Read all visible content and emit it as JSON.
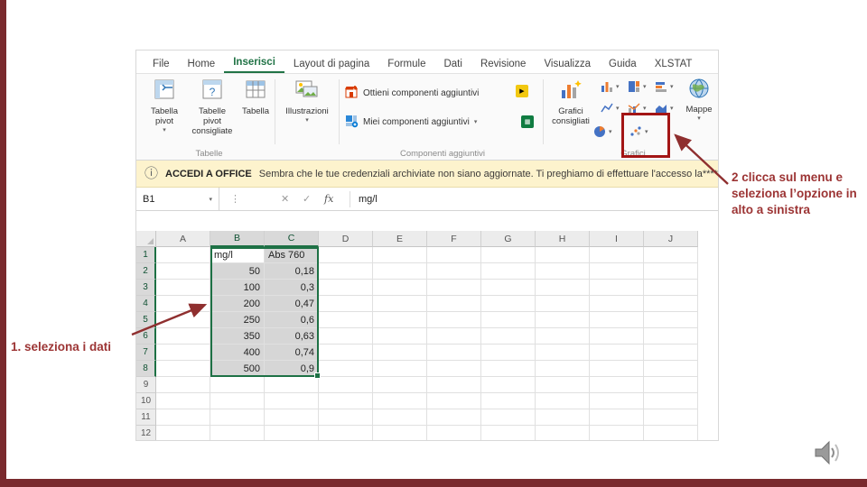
{
  "colors": {
    "accent_maroon": "#7a2a2e",
    "excel_green": "#217346",
    "annotation_red": "#9c3434",
    "highlight_box_red": "#a31515"
  },
  "annotations": {
    "step1_label": "1. seleziona i dati",
    "step2_label": "2 clicca sul menu e seleziona l’opzione in alto a sinistra"
  },
  "excel": {
    "tabs": [
      {
        "label": "File",
        "active": false
      },
      {
        "label": "Home",
        "active": false
      },
      {
        "label": "Inserisci",
        "active": true
      },
      {
        "label": "Layout di pagina",
        "active": false
      },
      {
        "label": "Formule",
        "active": false
      },
      {
        "label": "Dati",
        "active": false
      },
      {
        "label": "Revisione",
        "active": false
      },
      {
        "label": "Visualizza",
        "active": false
      },
      {
        "label": "Guida",
        "active": false
      },
      {
        "label": "XLSTAT",
        "active": false
      }
    ],
    "ribbon": {
      "pivot_table": "Tabella pivot",
      "recommended_pivot_tables": "Tabelle pivot consigliate",
      "table": "Tabella",
      "illustrations": "Illustrazioni",
      "get_addins": "Ottieni componenti aggiuntivi",
      "my_addins": "Miei componenti aggiuntivi",
      "recommended_charts": "Grafici consigliati",
      "maps": "Mappe",
      "group_tables": "Tabelle",
      "group_addins": "Componenti aggiuntivi",
      "group_charts": "Grafici",
      "chart_buttons": [
        {
          "name": "column-chart-button",
          "glyph": "column"
        },
        {
          "name": "hierarchy-chart-button",
          "glyph": "hierarchy"
        },
        {
          "name": "waterfall-chart-button",
          "glyph": "bar"
        },
        {
          "name": "line-chart-button",
          "glyph": "line"
        },
        {
          "name": "combo-chart-button",
          "glyph": "combo"
        },
        {
          "name": "area-chart-button",
          "glyph": "area"
        },
        {
          "name": "pie-chart-button",
          "glyph": "pie"
        },
        {
          "name": "scatter-chart-button",
          "glyph": "scatter"
        }
      ]
    },
    "message_bar": {
      "title": "ACCEDI A OFFICE",
      "text": "Sembra che le tue credenziali archiviate non siano aggiornate. Ti preghiamo di effettuare l'accesso la****"
    },
    "formula_bar": {
      "name_box": "B1",
      "cancel": "✕",
      "enter": "✓",
      "fx": "fx",
      "content": "mg/l"
    },
    "sheet": {
      "columns": [
        "A",
        "B",
        "C",
        "D",
        "E",
        "F",
        "G",
        "H",
        "I",
        "J"
      ],
      "row_count": 12,
      "selected_columns": [
        "B",
        "C"
      ],
      "selected_rows_through": 8,
      "active_cell": "B1",
      "cells": [
        {
          "row": 1,
          "B": "mg/l",
          "C": "Abs 760"
        },
        {
          "row": 2,
          "B": "50",
          "C": "0,18"
        },
        {
          "row": 3,
          "B": "100",
          "C": "0,3"
        },
        {
          "row": 4,
          "B": "200",
          "C": "0,47"
        },
        {
          "row": 5,
          "B": "250",
          "C": "0,6"
        },
        {
          "row": 6,
          "B": "350",
          "C": "0,63"
        },
        {
          "row": 7,
          "B": "400",
          "C": "0,74"
        },
        {
          "row": 8,
          "B": "500",
          "C": "0,9"
        }
      ]
    }
  }
}
